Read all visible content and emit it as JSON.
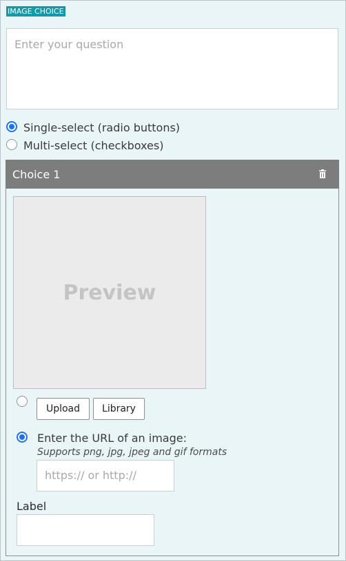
{
  "badge": "IMAGE CHOICE",
  "question": {
    "placeholder": "Enter your question"
  },
  "select_mode": {
    "single_label": "Single-select (radio buttons)",
    "multi_label": "Multi-select (checkboxes)",
    "selected": "single"
  },
  "choice": {
    "title": "Choice 1",
    "preview_text": "Preview",
    "upload_label": "Upload",
    "library_label": "Library",
    "url_option_label": "Enter the URL of an image:",
    "url_hint": "Supports png, jpg, jpeg and gif formats",
    "url_placeholder": "https:// or http://",
    "source_selected": "url",
    "label_title": "Label",
    "label_value": ""
  },
  "colors": {
    "badge": "#129aa9",
    "panel_bg": "#e9f5f7",
    "header_bg": "#7d7d7d",
    "radio_accent": "#1a73e8"
  }
}
